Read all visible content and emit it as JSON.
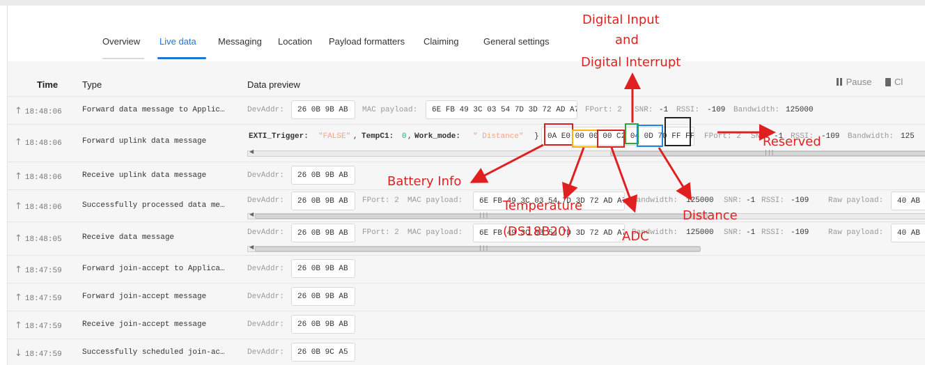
{
  "tabs": [
    "Overview",
    "Live data",
    "Messaging",
    "Location",
    "Payload formatters",
    "Claiming",
    "General settings"
  ],
  "columns": {
    "time": "Time",
    "type": "Type",
    "preview": "Data preview"
  },
  "actions": {
    "pause": "Pause",
    "clear": "Cl"
  },
  "rows": [
    {
      "time": "18:48:06",
      "type": "Forward data message to Applic…",
      "devaddr_label": "DevAddr:",
      "devaddr": "26 0B 9B AB",
      "mac_label": "MAC payload:",
      "mac": "6E FB 49 3C 03 54 7D 3D 72 AD A7",
      "fport": "FPort: 2",
      "snr_label": "SNR:",
      "snr": "-1",
      "rssi_label": "RSSI:",
      "rssi": "-109",
      "bw_label": "Bandwidth:",
      "bw": "125000"
    },
    {
      "time": "18:48:06",
      "type": "Forward uplink data message",
      "k1": "EXTI_Trigger:",
      "v1": "\"FALSE\"",
      "sep1": ",",
      "k2": "TempC1:",
      "v2": "0",
      "sep2": ",",
      "k3": "Work_mode:",
      "v3": "\" Distance\"",
      "brace": "}",
      "bytes": "0A E0 00 00 00 C2 04 0D 70 FF FF",
      "fport": "FPort: 2",
      "snr_label": "SNR:",
      "snr": "-1",
      "rssi_label": "RSSI:",
      "rssi": "-109",
      "bw_label": "Bandwidth:",
      "bw": "125"
    },
    {
      "time": "18:48:06",
      "type": "Receive uplink data message",
      "devaddr_label": "DevAddr:",
      "devaddr": "26 0B 9B AB"
    },
    {
      "time": "18:48:06",
      "type": "Successfully processed data me…",
      "devaddr_label": "DevAddr:",
      "devaddr": "26 0B 9B AB",
      "fport": "FPort: 2",
      "mac_label": "MAC payload:",
      "mac": "6E FB 49 3C 03 54 7D 3D 72 AD A7",
      "bw_label": "Bandwidth:",
      "bw": "125000",
      "snr_label": "SNR:",
      "snr": "-1",
      "rssi_label": "RSSI:",
      "rssi": "-109",
      "raw_label": "Raw payload:",
      "raw": "40 AB"
    },
    {
      "time": "18:48:05",
      "type": "Receive data message",
      "devaddr_label": "DevAddr:",
      "devaddr": "26 0B 9B AB",
      "fport": "FPort: 2",
      "mac_label": "MAC payload:",
      "mac": "6E FB 49 3C 03 54 7D 3D 72 AD A7",
      "bw_label": "Bandwidth:",
      "bw": "125000",
      "snr_label": "SNR:",
      "snr": "-1",
      "rssi_label": "RSSI:",
      "rssi": "-109",
      "raw_label": "Raw payload:",
      "raw": "40 AB"
    },
    {
      "time": "18:47:59",
      "type": "Forward join-accept to Applica…",
      "devaddr_label": "DevAddr:",
      "devaddr": "26 0B 9B AB"
    },
    {
      "time": "18:47:59",
      "type": "Forward join-accept message",
      "devaddr_label": "DevAddr:",
      "devaddr": "26 0B 9B AB"
    },
    {
      "time": "18:47:59",
      "type": "Receive join-accept message",
      "devaddr_label": "DevAddr:",
      "devaddr": "26 0B 9B AB"
    },
    {
      "time": "18:47:59",
      "type": "Successfully scheduled join-ac…",
      "devaddr_label": "DevAddr:",
      "devaddr": "26 0B 9C A5"
    }
  ],
  "annotations": {
    "digital_input": "Digital Input",
    "and": "and",
    "digital_interrupt": "Digital Interrupt",
    "reserved": "Reserved",
    "battery": "Battery Info",
    "temperature": "Temperature",
    "ds18b20": "(DS18B20)",
    "adc": "ADC",
    "distance": "Distance"
  },
  "colors": {
    "accent": "#1e74d8",
    "annotation": "#e02020",
    "box_red": "#d92020",
    "box_yellow": "#f2b600",
    "box_green": "#2fa82f",
    "box_blue": "#1e88e5",
    "box_black": "#222222"
  }
}
